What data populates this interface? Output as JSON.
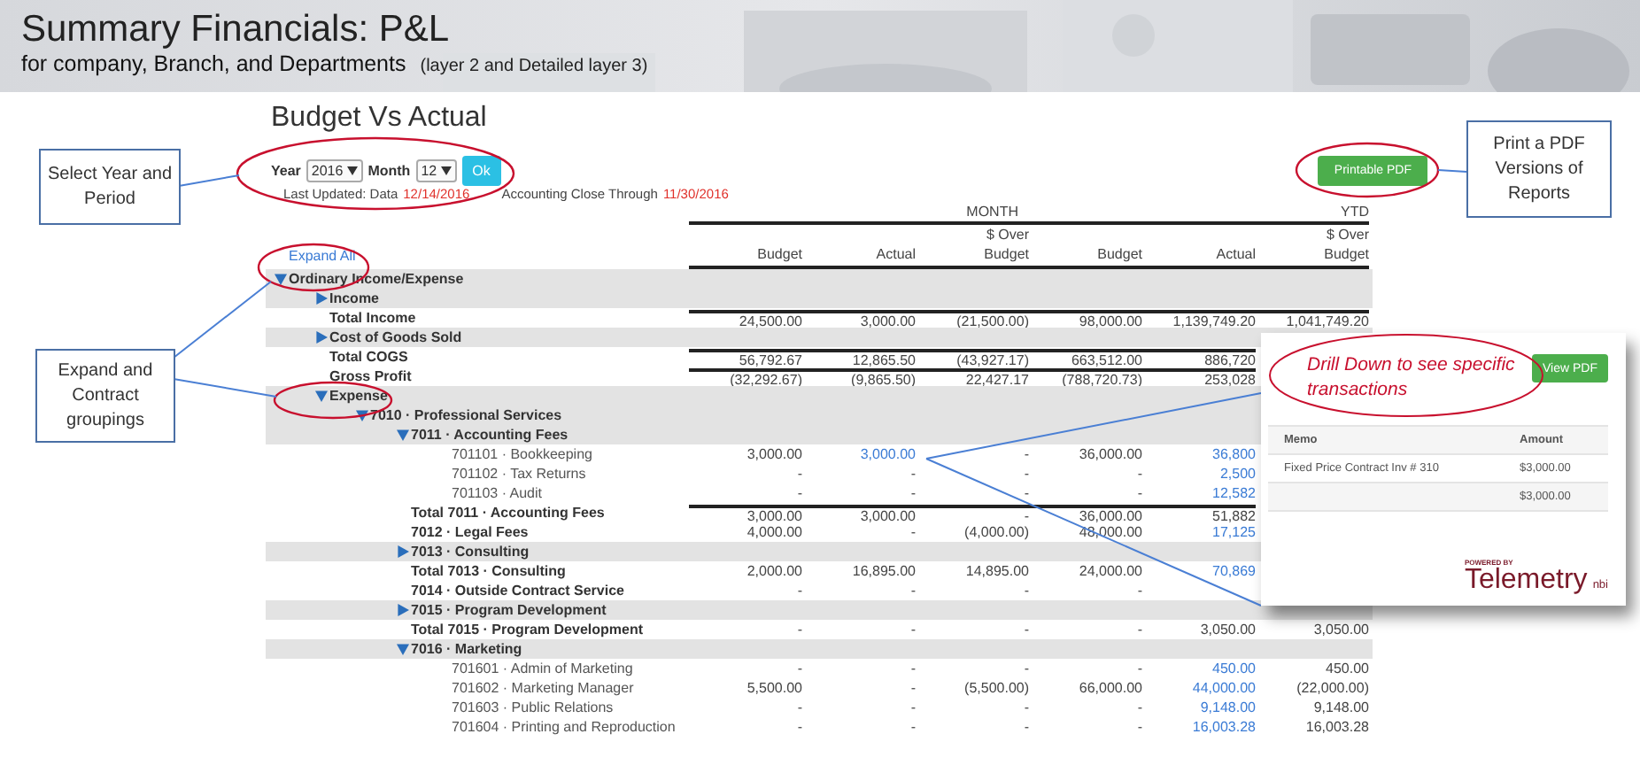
{
  "header": {
    "title": "Summary Financials: P&L",
    "subtitle": "for company, Branch, and Departments",
    "note": "(layer 2 and Detailed layer 3)"
  },
  "report": {
    "title": "Budget Vs Actual",
    "year_label": "Year",
    "year": "2016",
    "month_label": "Month",
    "month": "12",
    "ok": "Ok",
    "updated_label": "Last Updated: Data",
    "updated": "12/14/2016",
    "close_label": "Accounting Close Through",
    "close": "11/30/2016",
    "pdf_button": "Printable PDF"
  },
  "table": {
    "expand_all": "Expand All",
    "groups": [
      "MONTH",
      "YTD"
    ],
    "columns": [
      "Budget",
      "Actual",
      "$ Over Budget",
      "Budget",
      "Actual",
      "$ Over Budget"
    ],
    "rows": [
      {
        "kind": "group",
        "label": "Ordinary Income/Expense",
        "expanded": true,
        "children": [
          {
            "kind": "group",
            "label": "Income",
            "expanded": false
          },
          {
            "kind": "total",
            "label": "Total Income",
            "cells": [
              {
                "text": "24,500.00",
                "link": false
              },
              {
                "text": "3,000.00",
                "link": false
              },
              {
                "text": "(21,500.00)",
                "link": false
              },
              {
                "text": "98,000.00",
                "link": false
              },
              {
                "text": "1,139,749.20",
                "link": false
              },
              {
                "text": "1,041,749.20",
                "link": false
              }
            ]
          },
          {
            "kind": "group",
            "label": "Cost of Goods Sold",
            "expanded": false
          },
          {
            "kind": "total",
            "label": "Total COGS",
            "cells": [
              {
                "text": "56,792.67",
                "link": false
              },
              {
                "text": "12,865.50",
                "link": false
              },
              {
                "text": "(43,927.17)",
                "link": false
              },
              {
                "text": "663,512.00",
                "link": false
              },
              {
                "text": "886,720",
                "link": false
              }
            ]
          },
          {
            "kind": "total",
            "label": "Gross Profit",
            "cells": [
              {
                "text": "(32,292.67)",
                "link": false
              },
              {
                "text": "(9,865.50)",
                "link": false
              },
              {
                "text": "22,427.17",
                "link": false
              },
              {
                "text": "(788,720.73)",
                "link": false
              },
              {
                "text": "253,028",
                "link": false
              }
            ]
          },
          {
            "kind": "group",
            "label": "Expense",
            "expanded": true,
            "children": [
              {
                "kind": "group",
                "label": "7010 · Professional Services",
                "expanded": true,
                "children": [
                  {
                    "kind": "group",
                    "label": "7011 · Accounting Fees",
                    "expanded": true,
                    "children": [
                      {
                        "kind": "detail",
                        "label": "701101 · Bookkeeping",
                        "cells": [
                          {
                            "text": "3,000.00",
                            "link": false
                          },
                          {
                            "text": "3,000.00",
                            "link": true
                          },
                          {
                            "text": "-",
                            "link": false
                          },
                          {
                            "text": "36,000.00",
                            "link": false
                          },
                          {
                            "text": "36,800",
                            "link": true
                          }
                        ]
                      },
                      {
                        "kind": "detail",
                        "label": "701102 · Tax Returns",
                        "cells": [
                          {
                            "text": "-",
                            "link": false
                          },
                          {
                            "text": "-",
                            "link": false
                          },
                          {
                            "text": "-",
                            "link": false
                          },
                          {
                            "text": "-",
                            "link": false
                          },
                          {
                            "text": "2,500",
                            "link": true
                          }
                        ]
                      },
                      {
                        "kind": "detail",
                        "label": "701103 · Audit",
                        "cells": [
                          {
                            "text": "-",
                            "link": false
                          },
                          {
                            "text": "-",
                            "link": false
                          },
                          {
                            "text": "-",
                            "link": false
                          },
                          {
                            "text": "-",
                            "link": false
                          },
                          {
                            "text": "12,582",
                            "link": true
                          }
                        ]
                      }
                    ]
                  },
                  {
                    "kind": "total",
                    "label": "Total 7011 · Accounting Fees",
                    "cells": [
                      {
                        "text": "3,000.00",
                        "link": false
                      },
                      {
                        "text": "3,000.00",
                        "link": false
                      },
                      {
                        "text": "-",
                        "link": false
                      },
                      {
                        "text": "36,000.00",
                        "link": false
                      },
                      {
                        "text": "51,882",
                        "link": false
                      }
                    ]
                  },
                  {
                    "kind": "summary",
                    "label": "7012 · Legal Fees",
                    "cells": [
                      {
                        "text": "4,000.00",
                        "link": false
                      },
                      {
                        "text": "-",
                        "link": false
                      },
                      {
                        "text": "(4,000.00)",
                        "link": false
                      },
                      {
                        "text": "48,000.00",
                        "link": false
                      },
                      {
                        "text": "17,125",
                        "link": true
                      }
                    ]
                  },
                  {
                    "kind": "group",
                    "label": "7013 · Consulting",
                    "expanded": false
                  },
                  {
                    "kind": "summary",
                    "label": "Total 7013 · Consulting",
                    "cells": [
                      {
                        "text": "2,000.00",
                        "link": false
                      },
                      {
                        "text": "16,895.00",
                        "link": false
                      },
                      {
                        "text": "14,895.00",
                        "link": false
                      },
                      {
                        "text": "24,000.00",
                        "link": false
                      },
                      {
                        "text": "70,869",
                        "link": true
                      }
                    ]
                  },
                  {
                    "kind": "summary",
                    "label": "7014 · Outside Contract Service",
                    "cells": [
                      {
                        "text": "-",
                        "link": false
                      },
                      {
                        "text": "-",
                        "link": false
                      },
                      {
                        "text": "-",
                        "link": false
                      },
                      {
                        "text": "-",
                        "link": false
                      }
                    ]
                  },
                  {
                    "kind": "group",
                    "label": "7015 · Program Development",
                    "expanded": false
                  },
                  {
                    "kind": "summary",
                    "label": "Total 7015 · Program Development",
                    "cells": [
                      {
                        "text": "-",
                        "link": false
                      },
                      {
                        "text": "-",
                        "link": false
                      },
                      {
                        "text": "-",
                        "link": false
                      },
                      {
                        "text": "-",
                        "link": false
                      },
                      {
                        "text": "3,050.00",
                        "link": false
                      },
                      {
                        "text": "3,050.00",
                        "link": false
                      }
                    ]
                  },
                  {
                    "kind": "group",
                    "label": "7016 · Marketing",
                    "expanded": true,
                    "children": [
                      {
                        "kind": "detail",
                        "label": "701601 · Admin of Marketing",
                        "cells": [
                          {
                            "text": "-",
                            "link": false
                          },
                          {
                            "text": "-",
                            "link": false
                          },
                          {
                            "text": "-",
                            "link": false
                          },
                          {
                            "text": "-",
                            "link": false
                          },
                          {
                            "text": "450.00",
                            "link": true
                          },
                          {
                            "text": "450.00",
                            "link": false
                          }
                        ]
                      },
                      {
                        "kind": "detail",
                        "label": "701602 · Marketing Manager",
                        "cells": [
                          {
                            "text": "5,500.00",
                            "link": false
                          },
                          {
                            "text": "-",
                            "link": false
                          },
                          {
                            "text": "(5,500.00)",
                            "link": false
                          },
                          {
                            "text": "66,000.00",
                            "link": false
                          },
                          {
                            "text": "44,000.00",
                            "link": true
                          },
                          {
                            "text": "(22,000.00)",
                            "link": false
                          }
                        ]
                      },
                      {
                        "kind": "detail",
                        "label": "701603 · Public Relations",
                        "cells": [
                          {
                            "text": "-",
                            "link": false
                          },
                          {
                            "text": "-",
                            "link": false
                          },
                          {
                            "text": "-",
                            "link": false
                          },
                          {
                            "text": "-",
                            "link": false
                          },
                          {
                            "text": "9,148.00",
                            "link": true
                          },
                          {
                            "text": "9,148.00",
                            "link": false
                          }
                        ]
                      },
                      {
                        "kind": "detail",
                        "label": "701604 · Printing and Reproduction",
                        "cells": [
                          {
                            "text": "-",
                            "link": false
                          },
                          {
                            "text": "-",
                            "link": false
                          },
                          {
                            "text": "-",
                            "link": false
                          },
                          {
                            "text": "-",
                            "link": false
                          },
                          {
                            "text": "16,003.28",
                            "link": true
                          },
                          {
                            "text": "16,003.28",
                            "link": false
                          }
                        ]
                      }
                    ]
                  }
                ]
              }
            ]
          }
        ]
      }
    ]
  },
  "drilldown": {
    "note": "Drill Down to see specific transactions",
    "button": "View PDF",
    "columns": [
      "Memo",
      "Amount"
    ],
    "rows": [
      {
        "memo": "Fixed Price Contract Inv # 310",
        "amount": "$3,000.00"
      },
      {
        "amount": "$3,000.00"
      }
    ],
    "powered_by": "POWERED BY",
    "brand": "Telemetry",
    "brand_suffix": "nbi"
  },
  "callouts": [
    {
      "text": "Select Year and Period"
    },
    {
      "text": "Expand and Contract groupings"
    },
    {
      "text": "Print a PDF Versions of Reports"
    }
  ]
}
